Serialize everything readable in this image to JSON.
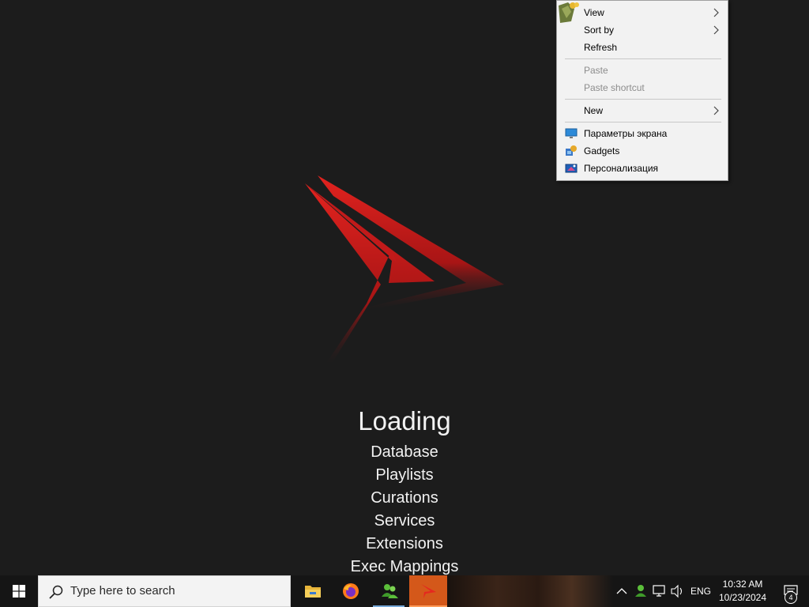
{
  "splash": {
    "title": "Loading",
    "steps": [
      "Database",
      "Playlists",
      "Curations",
      "Services",
      "Extensions",
      "Exec Mappings"
    ],
    "logo_colors": {
      "top": "#e01f1f",
      "bottom": "#5a0c0c"
    }
  },
  "context_menu": {
    "items": {
      "view": {
        "label": "View",
        "submenu": true
      },
      "sort_by": {
        "label": "Sort by",
        "submenu": true
      },
      "refresh": {
        "label": "Refresh"
      },
      "paste": {
        "label": "Paste",
        "disabled": true
      },
      "paste_shortcut": {
        "label": "Paste shortcut",
        "disabled": true
      },
      "new": {
        "label": "New",
        "submenu": true
      },
      "display_settings": {
        "label": "Параметры экрана",
        "icon": "monitor-icon"
      },
      "gadgets": {
        "label": "Gadgets",
        "icon": "gadgets-icon"
      },
      "personalize": {
        "label": "Персонализация",
        "icon": "personalize-icon"
      }
    }
  },
  "taskbar": {
    "search_placeholder": "Type here to search",
    "pinned": [
      {
        "name": "file-explorer",
        "icon": "folder-icon"
      },
      {
        "name": "firefox",
        "icon": "firefox-icon"
      },
      {
        "name": "users-app",
        "icon": "users-icon"
      },
      {
        "name": "flashpoint",
        "icon": "flashpoint-icon",
        "active": true
      }
    ],
    "tray": {
      "language": "ENG",
      "time": "10:32 AM",
      "date": "10/23/2024",
      "notification_count": "4"
    }
  }
}
